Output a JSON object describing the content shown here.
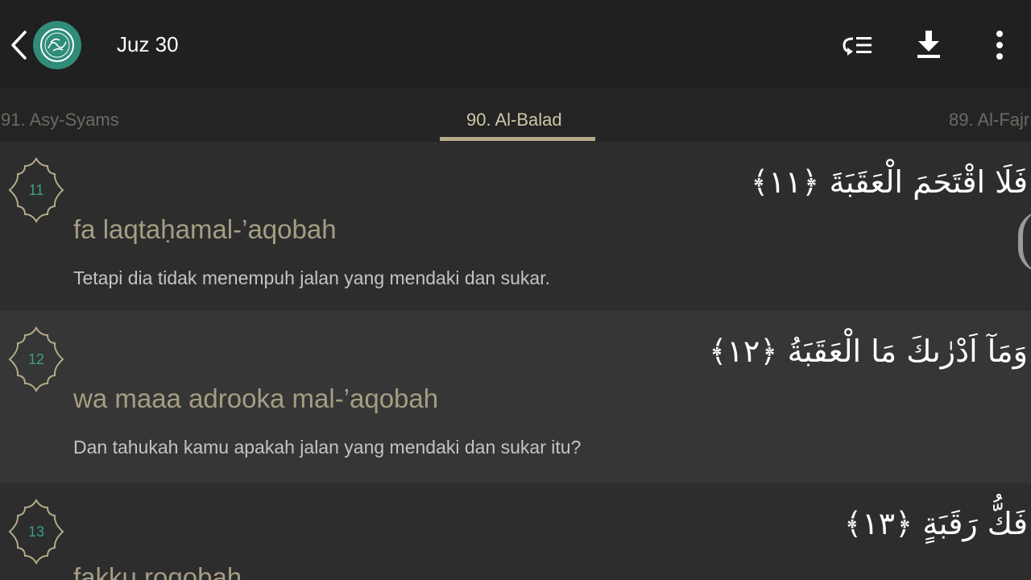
{
  "appbar": {
    "title": "Juz 30",
    "back_icon": "chevron-left-icon",
    "logo_icon": "quran-logo-icon",
    "actions": [
      {
        "name": "repeat-list-icon"
      },
      {
        "name": "download-icon"
      },
      {
        "name": "more-vertical-icon"
      }
    ]
  },
  "tabs": {
    "prev": "91. Asy-Syams",
    "active": "90. Al-Balad",
    "next": "89. Al-Fajr"
  },
  "verses": [
    {
      "number": "11",
      "arabic": "فَلَا اقْتَحَمَ الْعَقَبَةَ ﴿١١﴾",
      "latin": "fa laqtaḥamal-’aqobah",
      "translation": "Tetapi dia tidak menempuh jalan yang mendaki dan sukar."
    },
    {
      "number": "12",
      "arabic": "وَمَآ اَدْرٰىكَ مَا الْعَقَبَةُ ﴿١٢﴾",
      "latin": "wa maaa adrooka mal-’aqobah",
      "translation": "Dan tahukah kamu apakah jalan yang mendaki dan sukar itu?"
    },
    {
      "number": "13",
      "arabic": "فَكُّ رَقَبَةٍ ﴿١٣﴾",
      "latin": "fakku roqobah",
      "translation": ""
    }
  ],
  "colors": {
    "appbar_bg": "#1f201f",
    "tab_bg": "#232423",
    "accent": "#b5aa88",
    "latin_text": "#a69d83",
    "verse_number": "#3f9c8a",
    "logo_bg": "#2f8c79"
  }
}
